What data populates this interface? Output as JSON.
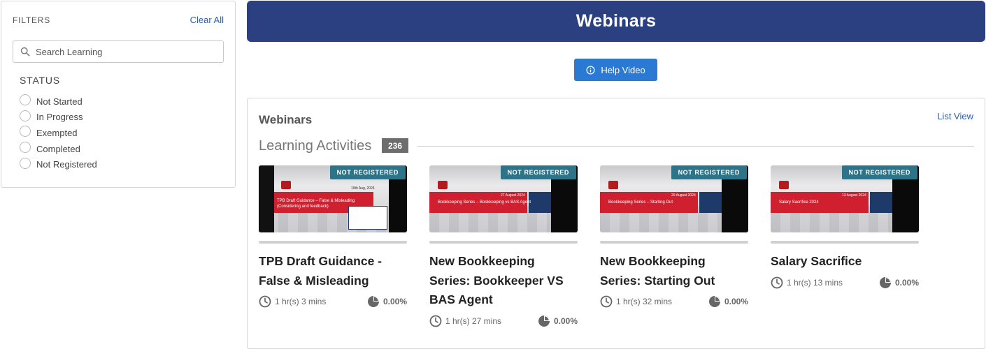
{
  "filters": {
    "title": "FILTERS",
    "clear_all": "Clear All",
    "search_placeholder": "Search Learning",
    "status_title": "STATUS",
    "status_options": [
      "Not Started",
      "In Progress",
      "Exempted",
      "Completed",
      "Not Registered"
    ]
  },
  "header": {
    "title": "Webinars"
  },
  "help_button": {
    "label": "Help Video",
    "icon": "info-circle-icon"
  },
  "panel": {
    "title": "Webinars",
    "list_view": "List View",
    "learning_activities": "Learning Activities",
    "count": "236"
  },
  "cards": [
    {
      "badge": "NOT REGISTERED",
      "title": "TPB Draft Guidance - False & Misleading",
      "duration": "1 hr(s) 3 mins",
      "percent": "0.00%",
      "progress": 0,
      "thumb_heading": "TPB Draft Guidance – False & Misleading",
      "thumb_sub": "(Considering and feedback)",
      "thumb_date": "19th Aug, 2024"
    },
    {
      "badge": "NOT REGISTERED",
      "title": "New Bookkeeping Series: Bookkeeper VS BAS Agent",
      "duration": "1 hr(s) 27 mins",
      "percent": "0.00%",
      "progress": 0,
      "thumb_heading": "Bookkeeping Series – Bookkeeping vs BAS Agent",
      "thumb_date": "27 August 2024"
    },
    {
      "badge": "NOT REGISTERED",
      "title": "New Bookkeeping Series: Starting Out",
      "duration": "1 hr(s) 32 mins",
      "percent": "0.00%",
      "progress": 0,
      "thumb_heading": "Bookkeeping Series – Starting Out",
      "thumb_date": "20 August 2024"
    },
    {
      "badge": "NOT REGISTERED",
      "title": "Salary Sacrifice",
      "duration": "1 hr(s) 13 mins",
      "percent": "0.00%",
      "progress": 0,
      "thumb_heading": "Salary Sacrifice 2024",
      "thumb_date": "13 August 2024"
    }
  ],
  "colors": {
    "header_bg": "#2a4080",
    "button_bg": "#2a79d3",
    "badge_bg": "#2d7488",
    "link": "#2d5ea8"
  }
}
